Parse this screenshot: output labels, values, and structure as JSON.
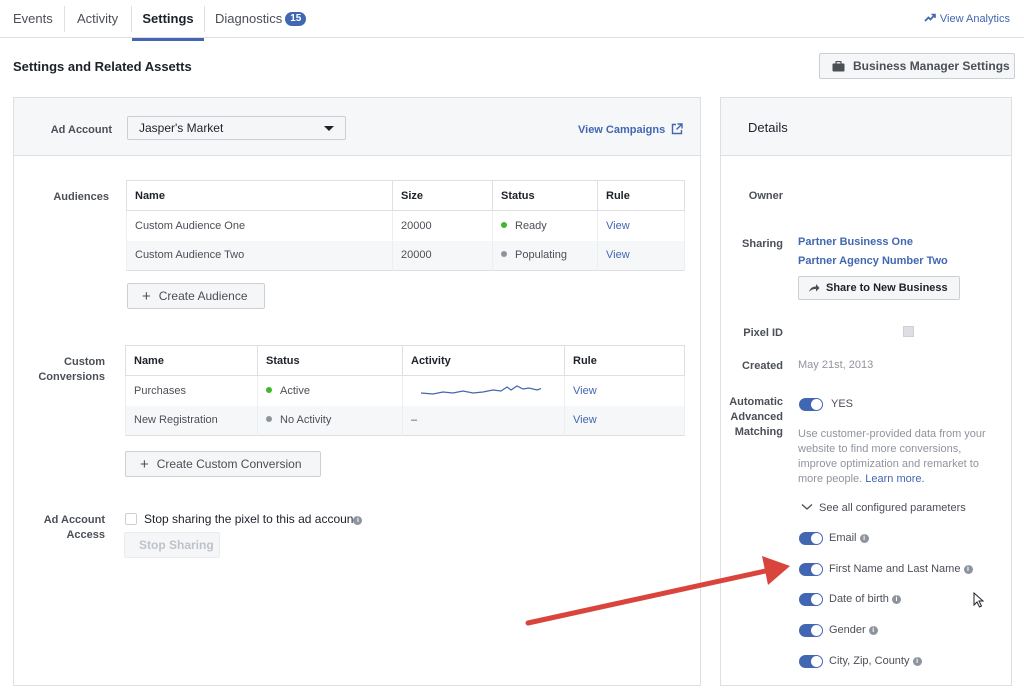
{
  "tabs": [
    {
      "label": "Events"
    },
    {
      "label": "Activity"
    },
    {
      "label": "Settings"
    },
    {
      "label": "Diagnostics",
      "badge": "15"
    }
  ],
  "view_analytics": "View Analytics",
  "page_title": "Settings and Related Assetts",
  "business_manager_button": "Business Manager Settings",
  "ad_account": {
    "label": "Ad Account",
    "selected": "Jasper's Market",
    "view_campaigns": "View Campaigns"
  },
  "audiences": {
    "label": "Audiences",
    "columns": [
      "Name",
      "Size",
      "Status",
      "Rule"
    ],
    "rows": [
      {
        "name": "Custom Audience One",
        "size": "20000",
        "status": "Ready",
        "status_color": "#42b72a",
        "rule": "View"
      },
      {
        "name": "Custom Audience Two",
        "size": "20000",
        "status": "Populating",
        "status_color": "#90949c",
        "rule": "View"
      }
    ],
    "create_button": "Create Audience"
  },
  "conversions": {
    "label_line1": "Custom",
    "label_line2": "Conversions",
    "columns": [
      "Name",
      "Status",
      "Activity",
      "Rule"
    ],
    "rows": [
      {
        "name": "Purchases",
        "status": "Active",
        "status_color": "#42b72a",
        "activity": "",
        "rule": "View"
      },
      {
        "name": "New Registration",
        "status": "No Activity",
        "status_color": "#90949c",
        "activity": "–",
        "rule": "View"
      }
    ],
    "create_button": "Create Custom Conversion"
  },
  "access": {
    "label_line1": "Ad Account",
    "label_line2": "Access",
    "checkbox_label": "Stop sharing the pixel to this ad accoun",
    "stop_button": "Stop Sharing"
  },
  "details": {
    "title": "Details",
    "owner_label": "Owner",
    "sharing_label": "Sharing",
    "sharing_partners": [
      "Partner Business One",
      "Partner Agency Number Two"
    ],
    "share_button": "Share to New Business",
    "pixel_id_label": "Pixel ID",
    "created_label": "Created",
    "created_value": "May 21st, 2013",
    "aam_label_line1": "Automatic",
    "aam_label_line2": "Advanced",
    "aam_label_line3": "Matching",
    "aam_value": "YES",
    "aam_description": "Use customer-provided data from your website to find more conversions, improve optimization and remarket to more people.",
    "learn_more": "Learn more.",
    "see_all": "See all configured parameters",
    "parameters": [
      {
        "label": "Email"
      },
      {
        "label": "First Name and Last Name"
      },
      {
        "label": "Date of birth"
      },
      {
        "label": "Gender"
      },
      {
        "label": "City, Zip, County"
      }
    ]
  },
  "colors": {
    "accent": "#4267b2",
    "arrow": "#d9453c"
  }
}
